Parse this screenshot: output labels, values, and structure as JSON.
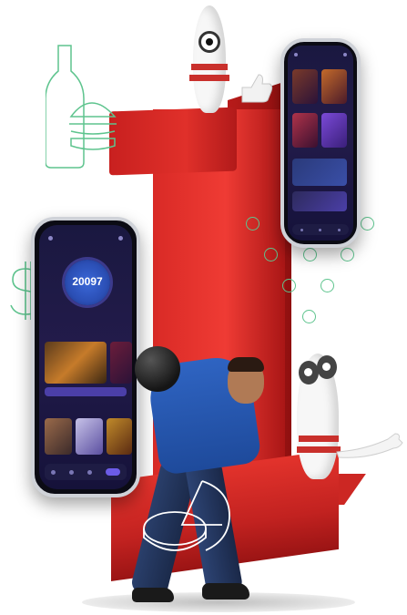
{
  "phone_main": {
    "score": "20097"
  },
  "colors": {
    "brand_red": "#e0302a",
    "app_purple": "#221b4a",
    "accent_green": "#5ec48e",
    "shirt_blue": "#2f64c2"
  },
  "icons": [
    "bottle-icon",
    "burger-icon",
    "dollar-icon",
    "coins-icon",
    "bubbles-icon"
  ]
}
